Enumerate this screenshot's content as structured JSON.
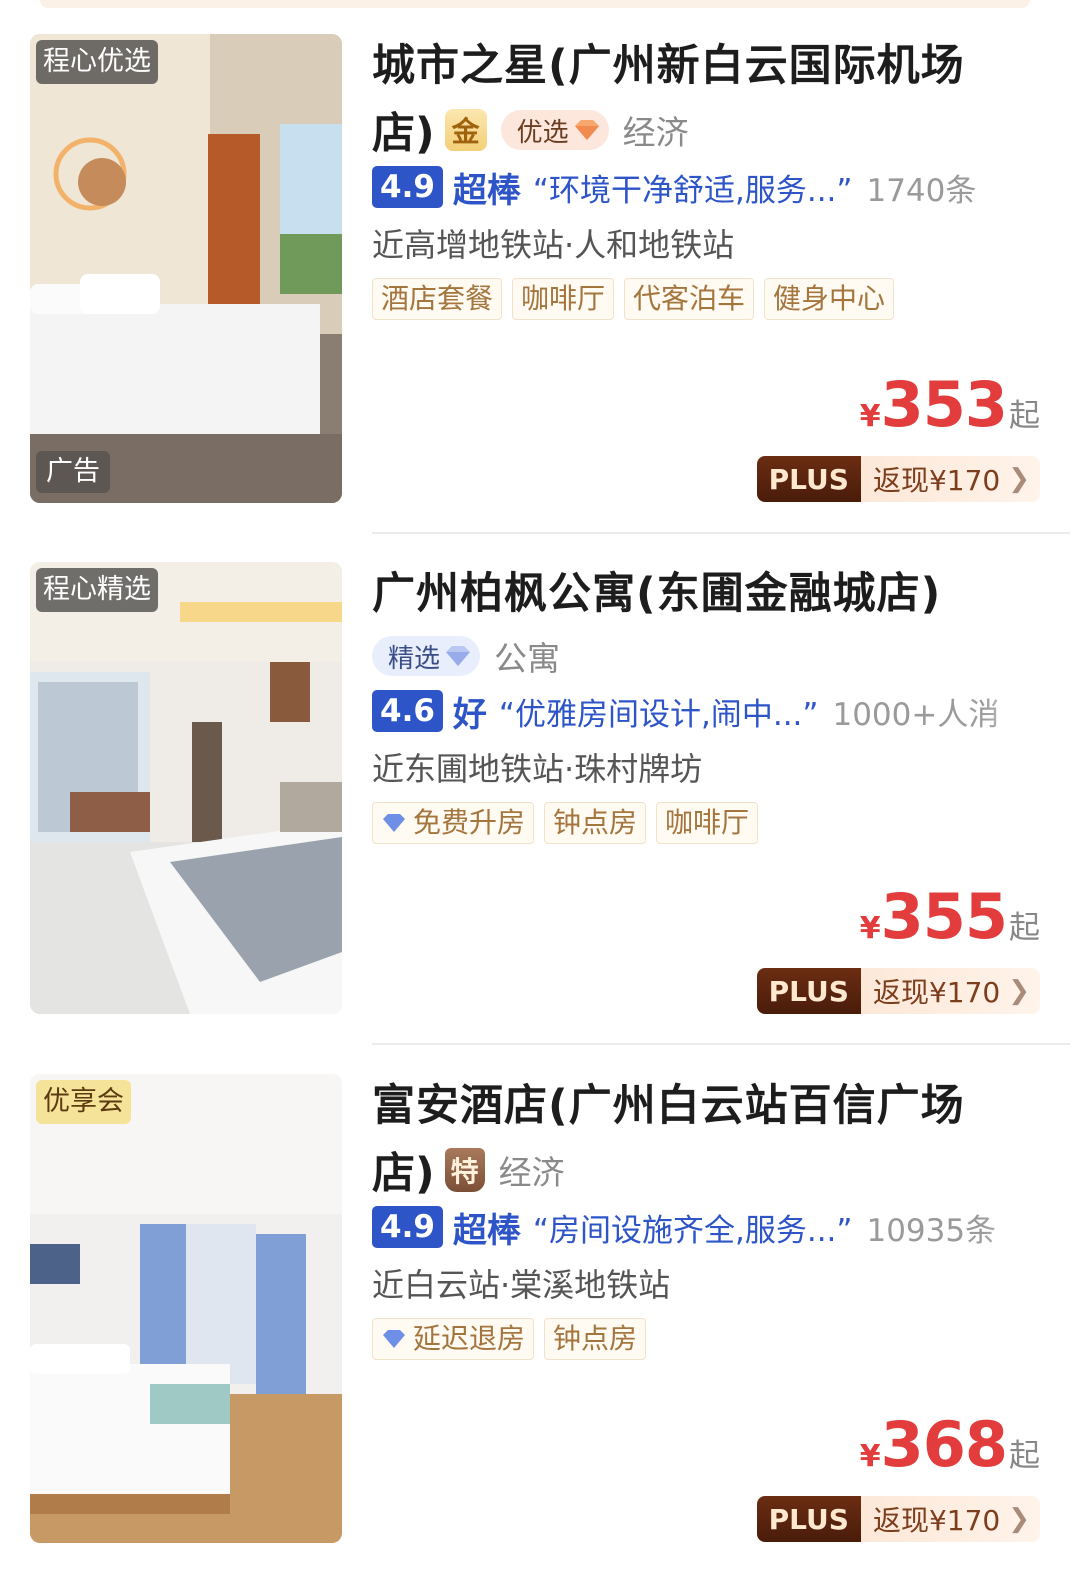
{
  "hotels": [
    {
      "image_badge": "程心优选",
      "ad_label": "广告",
      "title_line1": "城市之星(广州新白云国际机场",
      "title_line2": "店)",
      "tier_badge": "金",
      "select_badge": "优选",
      "category": "经济",
      "score": "4.9",
      "score_level": "超棒",
      "review_quote": "“环境干净舒适,服务...”",
      "review_count": "1740条",
      "nearby": "近高增地铁站·人和地铁站",
      "tags": [
        "酒店套餐",
        "咖啡厅",
        "代客泊车",
        "健身中心"
      ],
      "price_symbol": "¥",
      "price": "353",
      "price_suffix": "起",
      "plus_label": "PLUS",
      "cashback": "返现¥170"
    },
    {
      "image_badge": "程心精选",
      "title_line1": "广州柏枫公寓(东圃金融城店)",
      "select_badge": "精选",
      "category": "公寓",
      "score": "4.6",
      "score_level": "好",
      "review_quote": "“优雅房间设计,闹中...”",
      "review_count": "1000+人消",
      "nearby": "近东圃地铁站·珠村牌坊",
      "tags": [
        "免费升房",
        "钟点房",
        "咖啡厅"
      ],
      "price_symbol": "¥",
      "price": "355",
      "price_suffix": "起",
      "plus_label": "PLUS",
      "cashback": "返现¥170"
    },
    {
      "image_badge": "优享会",
      "title_line1": "富安酒店(广州白云站百信广场",
      "title_line2": "店)",
      "tier_badge": "特",
      "category": "经济",
      "score": "4.9",
      "score_level": "超棒",
      "review_quote": "“房间设施齐全,服务...”",
      "review_count": "10935条",
      "nearby": "近白云站·棠溪地铁站",
      "tags": [
        "延迟退房",
        "钟点房"
      ],
      "price_symbol": "¥",
      "price": "368",
      "price_suffix": "起",
      "plus_label": "PLUS",
      "cashback": "返现¥170"
    }
  ],
  "icons": {
    "chevron": "chevron-right-icon",
    "gem": "diamond-icon"
  },
  "colors": {
    "accent_blue": "#2e55c8",
    "price_red": "#e23c3c",
    "plus_brown": "#5a2410"
  }
}
